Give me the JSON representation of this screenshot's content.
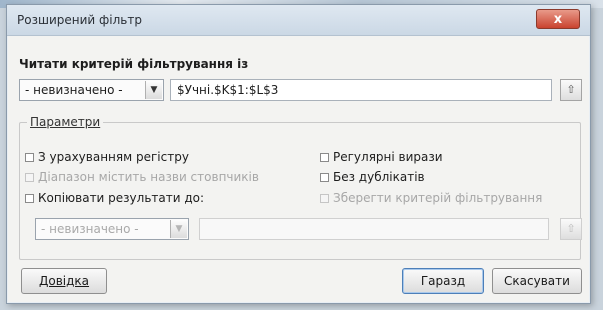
{
  "dialog": {
    "title": "Розширений фільтр",
    "close_label": "x"
  },
  "criteria": {
    "label": "Читати критерій фільтрування із",
    "source_select_value": "- невизначено -",
    "range_value": "$Учні.$K$1:$L$3"
  },
  "options": {
    "group_label": "Параметри",
    "case_sensitive": "З урахуванням регістру",
    "range_has_headers": "Діапазон містить назви стовпчиків",
    "copy_results_to": "Копіювати результати до:",
    "regular_expressions": "Регулярні вирази",
    "no_duplicates": "Без дублікатів",
    "keep_criteria": "Зберегти критерій фільтрування",
    "copy_select_value": "- невизначено -",
    "copy_target_value": ""
  },
  "buttons": {
    "help": "Довідка",
    "ok": "Гаразд",
    "cancel": "Скасувати"
  },
  "icons": {
    "close": "close-icon",
    "dropdown": "chevron-down-icon",
    "shrink": "shrink-dialog-icon"
  }
}
